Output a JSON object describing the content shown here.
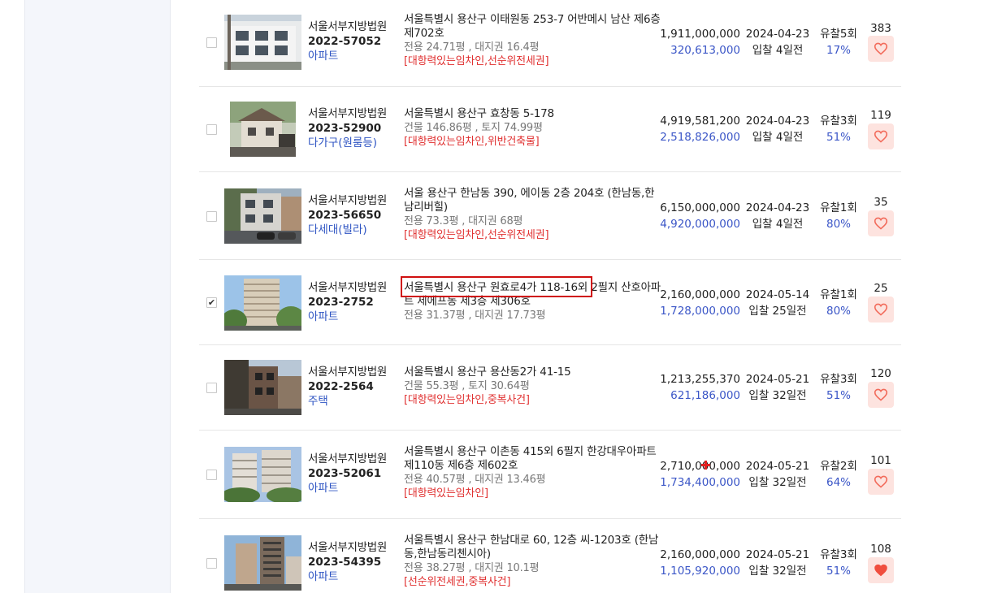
{
  "colors": {
    "accent_blue": "#3b56c7",
    "note_red": "#e03030",
    "heart_bg": "#fde3df",
    "heart": "#f26b5b",
    "highlight_box": "#d01010"
  },
  "listings": [
    {
      "checked": false,
      "court": "서울서부지방법원",
      "case_no": "2022-57052",
      "type": "아파트",
      "address": "서울특별시 용산구 이태원동 253-7 어반메시 남산 제6층 제702호",
      "area": "전용 24.71평 , 대지권 16.4평",
      "note": "[대항력있는임차인,선순위전세권]",
      "appraisal": "1,911,000,000",
      "min_bid": "320,613,000",
      "date": "2024-04-23",
      "dday": "입찰 4일전",
      "failed": "유찰5회",
      "rate": "17%",
      "views": "383",
      "favorite": false,
      "thumb_icon": "apartment-building-photo"
    },
    {
      "checked": false,
      "court": "서울서부지방법원",
      "case_no": "2023-52900",
      "type": "다가구(원룸등)",
      "address": "서울특별시 용산구 효창동 5-178",
      "area": "건물 146.86평 , 토지 74.99평",
      "note": "[대항력있는임차인,위반건축물]",
      "appraisal": "4,919,581,200",
      "min_bid": "2,518,826,000",
      "date": "2024-04-23",
      "dday": "입찰 4일전",
      "failed": "유찰3회",
      "rate": "51%",
      "views": "119",
      "favorite": false,
      "thumb_icon": "house-photo"
    },
    {
      "checked": false,
      "court": "서울서부지방법원",
      "case_no": "2023-56650",
      "type": "다세대(빌라)",
      "address": "서울 용산구 한남동 390, 에이동 2층 204호 (한남동,한남리버힐)",
      "area": "전용 73.3평 , 대지권 68평",
      "note": "[대항력있는임차인,선순위전세권]",
      "appraisal": "6,150,000,000",
      "min_bid": "4,920,000,000",
      "date": "2024-04-23",
      "dday": "입찰 4일전",
      "failed": "유찰1회",
      "rate": "80%",
      "views": "35",
      "favorite": false,
      "thumb_icon": "villa-photo"
    },
    {
      "checked": true,
      "court": "서울서부지방법원",
      "case_no": "2023-2752",
      "type": "아파트",
      "address": "서울특별시 용산구 원효로4가 118-16외 2필지 산호아파트 제에프동 제3층 제306호",
      "area": "전용 31.37평 , 대지권 17.73평",
      "note": "",
      "appraisal": "2,160,000,000",
      "min_bid": "1,728,000,000",
      "date": "2024-05-14",
      "dday": "입찰 25일전",
      "failed": "유찰1회",
      "rate": "80%",
      "views": "25",
      "favorite": false,
      "thumb_icon": "apartment-tower-photo"
    },
    {
      "checked": false,
      "court": "서울서부지방법원",
      "case_no": "2022-2564",
      "type": "주택",
      "address": "서울특별시 용산구 용산동2가 41-15",
      "area": "건물 55.3평 , 토지 30.64평",
      "note": "[대항력있는임차인,중복사건]",
      "appraisal": "1,213,255,370",
      "min_bid": "621,186,000",
      "date": "2024-05-21",
      "dday": "입찰 32일전",
      "failed": "유찰3회",
      "rate": "51%",
      "views": "120",
      "favorite": false,
      "thumb_icon": "house-photo"
    },
    {
      "checked": false,
      "court": "서울서부지방법원",
      "case_no": "2023-52061",
      "type": "아파트",
      "address": "서울특별시 용산구 이촌동 415외 6필지 한강대우아파트 제110동 제6층 제602호",
      "area": "전용 40.57평 , 대지권 13.46평",
      "note": "[대항력있는임차인]",
      "appraisal": "2,710,000,000",
      "min_bid": "1,734,400,000",
      "date": "2024-05-21",
      "dday": "입찰 32일전",
      "failed": "유찰2회",
      "rate": "64%",
      "views": "101",
      "favorite": false,
      "thumb_icon": "apartment-complex-photo"
    },
    {
      "checked": false,
      "court": "서울서부지방법원",
      "case_no": "2023-54395",
      "type": "아파트",
      "address": "서울특별시 용산구 한남대로 60, 12층 씨-1203호 (한남동,한남동리첸시아)",
      "area": "전용 38.27평 , 대지권 10.1평",
      "note": "[선순위전세권,중복사건]",
      "appraisal": "2,160,000,000",
      "min_bid": "1,105,920,000",
      "date": "2024-05-21",
      "dday": "입찰 32일전",
      "failed": "유찰3회",
      "rate": "51%",
      "views": "108",
      "favorite": true,
      "thumb_icon": "high-rise-photo"
    }
  ]
}
